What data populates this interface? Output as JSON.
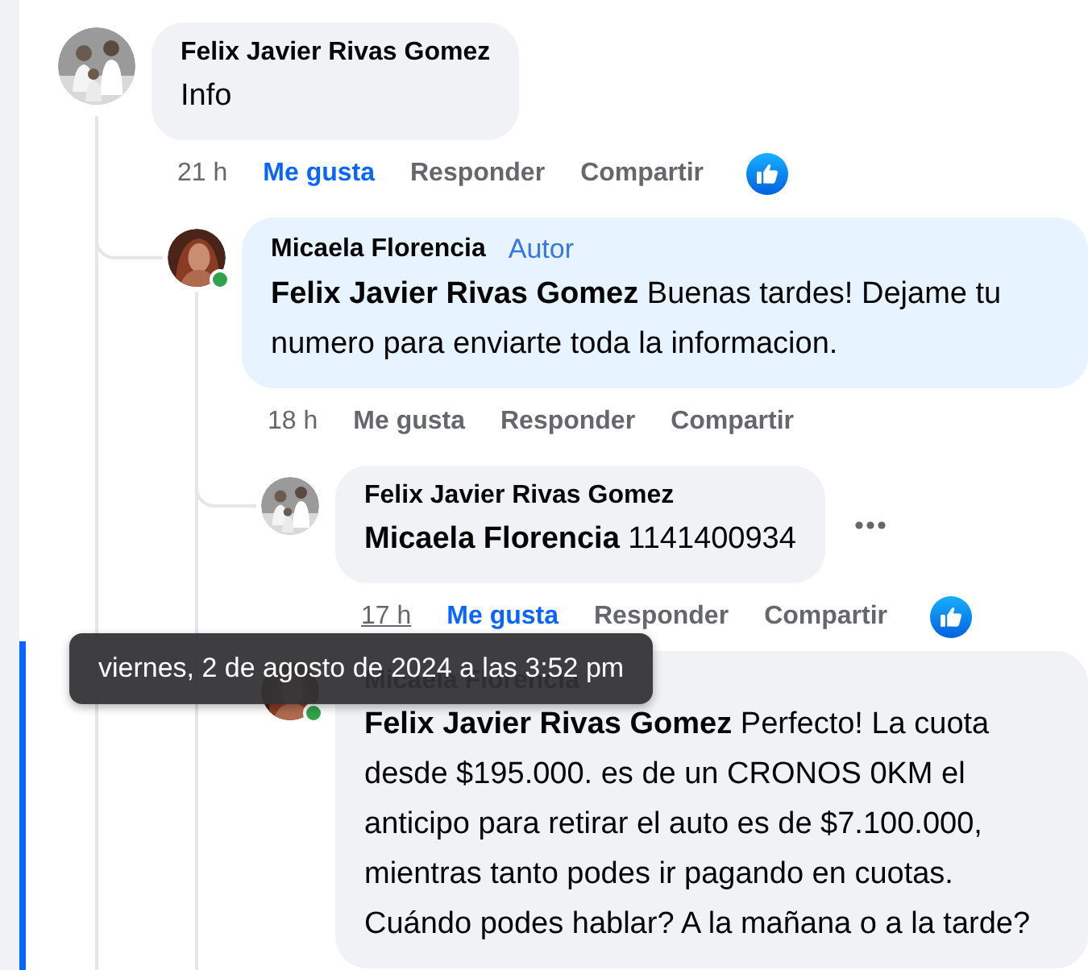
{
  "comments": [
    {
      "author": "Felix Javier Rivas Gomez",
      "avatar": {
        "kind": "group"
      },
      "text": "Info",
      "time": "21 h",
      "time_hovered": false,
      "like_label": "Me gusta",
      "liked": true,
      "reply_label": "Responder",
      "share_label": "Compartir",
      "reaction": true,
      "children": [
        {
          "author": "Micaela Florencia",
          "badge": "Autor",
          "avatar": {
            "kind": "portrait"
          },
          "online": true,
          "text": "**Felix Javier Rivas Gomez** Buenas tardes! Dejame tu numero para enviarte toda la informacion.",
          "time": "18 h",
          "time_hovered": false,
          "like_label": "Me gusta",
          "liked": false,
          "reply_label": "Responder",
          "share_label": "Compartir",
          "children": [
            {
              "author": "Felix Javier Rivas Gomez",
              "avatar": {
                "kind": "group"
              },
              "text": "**Micaela Florencia** 1141400934",
              "time": "17 h",
              "time_hovered": true,
              "like_label": "Me gusta",
              "liked": true,
              "reply_label": "Responder",
              "share_label": "Compartir",
              "reaction": true,
              "more_menu": true
            },
            {
              "author": "Micaela Florencia",
              "avatar": {
                "kind": "portrait"
              },
              "online": true,
              "highlighted": true,
              "text": "**Felix Javier Rivas Gomez** Perfecto! La cuota desde $195.000. es de un CRONOS 0KM el anticipo para retirar el auto es de $7.100.000, mientras tanto podes ir pagando en cuotas. Cuándo podes hablar? A la mañana o a la tarde?"
            }
          ]
        }
      ]
    }
  ],
  "tooltip": {
    "text": "viernes, 2 de agosto de 2024 a las 3:52 pm"
  }
}
